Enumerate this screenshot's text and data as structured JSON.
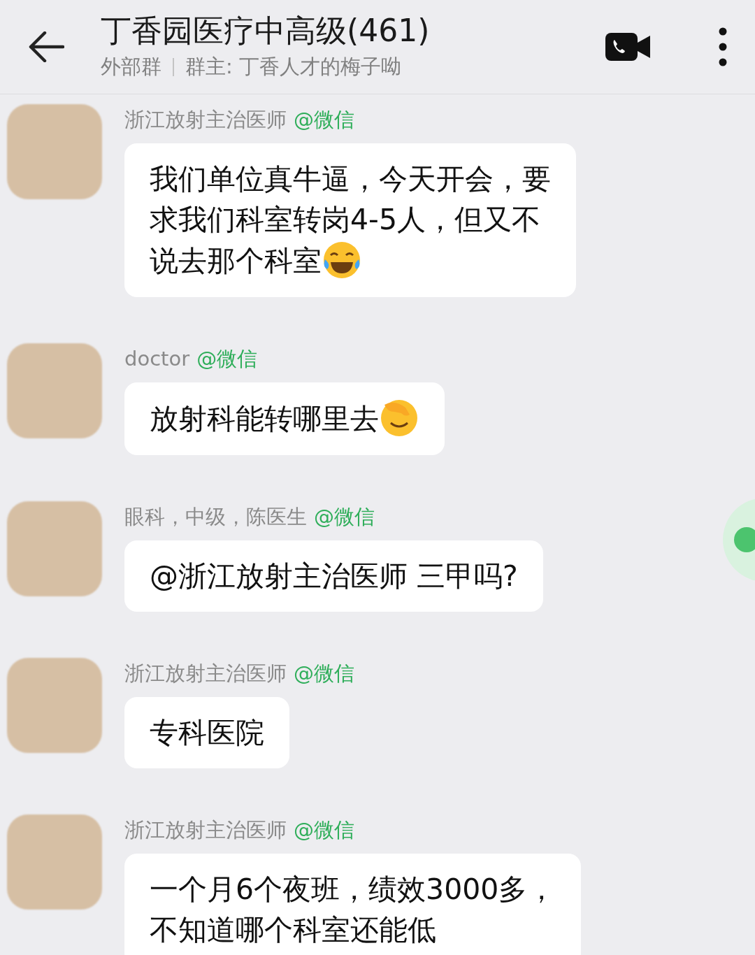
{
  "header": {
    "title": "丁香园医疗中高级(461)",
    "group_type": "外部群",
    "owner": "群主: 丁香人才的梅子呦"
  },
  "messages": [
    {
      "kind": "laughing",
      "sender": "浙江放射主治医师",
      "source": "@微信",
      "lines": [
        "我们单位真牛逼，今天开会，要",
        "求我们科室转岗4-5人，但又不",
        "说去那个科室"
      ]
    },
    {
      "kind": "facepalm",
      "sender": "doctor",
      "source": "@微信",
      "lines": [
        "放射科能转哪里去"
      ]
    },
    {
      "kind": "plain",
      "sender": "眼科，中级，陈医生",
      "source": "@微信",
      "lines": [
        "@浙江放射主治医师 三甲吗?"
      ]
    },
    {
      "kind": "plain",
      "sender": "浙江放射主治医师",
      "source": "@微信",
      "lines": [
        "专科医院"
      ]
    },
    {
      "kind": "plain",
      "sender": "浙江放射主治医师",
      "source": "@微信",
      "lines": [
        "一个月6个夜班，绩效3000多，",
        "不知道哪个科室还能低"
      ]
    }
  ]
}
